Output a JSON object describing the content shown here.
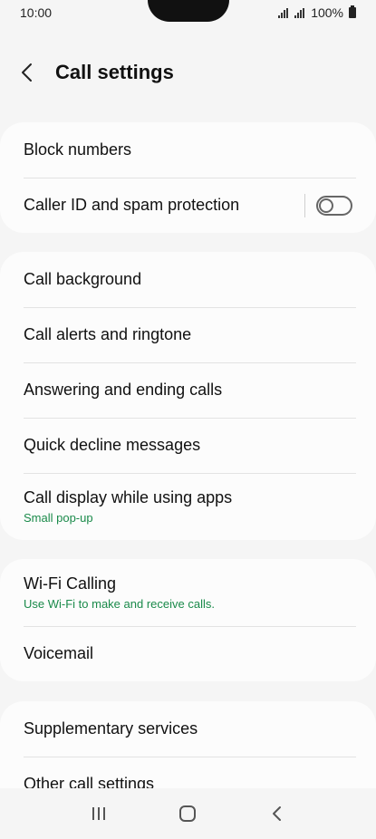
{
  "status_bar": {
    "time": "10:00",
    "battery": "100%"
  },
  "header": {
    "title": "Call settings"
  },
  "sections": [
    {
      "items": [
        {
          "label": "Block numbers"
        },
        {
          "label": "Caller ID and spam protection",
          "toggle": false
        }
      ]
    },
    {
      "items": [
        {
          "label": "Call background"
        },
        {
          "label": "Call alerts and ringtone"
        },
        {
          "label": "Answering and ending calls"
        },
        {
          "label": "Quick decline messages"
        },
        {
          "label": "Call display while using apps",
          "sub": "Small pop-up"
        }
      ]
    },
    {
      "items": [
        {
          "label": "Wi-Fi Calling",
          "sub": "Use Wi-Fi to make and receive calls."
        },
        {
          "label": "Voicemail"
        }
      ]
    },
    {
      "items": [
        {
          "label": "Supplementary services"
        },
        {
          "label": "Other call settings"
        }
      ]
    }
  ],
  "colors": {
    "accent": "#1a8a4a",
    "background": "#f5f5f5",
    "card": "#fcfcfc"
  }
}
